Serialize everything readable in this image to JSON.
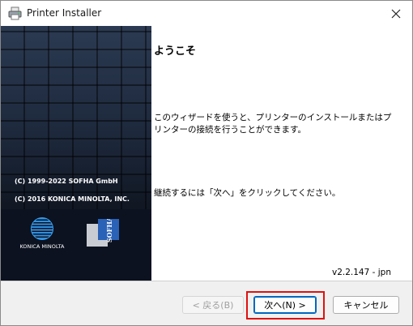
{
  "window": {
    "title": "Printer Installer",
    "app_icon": "printer-icon",
    "close_icon": "close-icon"
  },
  "sidebar": {
    "copyright_1": "(C) 1999-2022 SOFHA GmbH",
    "copyright_2": "(C) 2016 KONICA MINOLTA, INC.",
    "logo_text": "KONICA MINOLTA",
    "sofha_logo_text": "SOFHA"
  },
  "main": {
    "heading": "ようこそ",
    "description": "このウィザードを使うと、プリンターのインストールまたはプリンターの接続を行うことができます。",
    "instruction": "継続するには「次へ」をクリックしてください。",
    "version": "v2.2.147 - jpn"
  },
  "footer": {
    "back_label": "< 戻る(B)",
    "next_label": "次へ(N) >",
    "cancel_label": "キャンセル"
  },
  "colors": {
    "accent": "#0067c0",
    "highlight": "#e01010",
    "sidebar": "#1c273a"
  }
}
